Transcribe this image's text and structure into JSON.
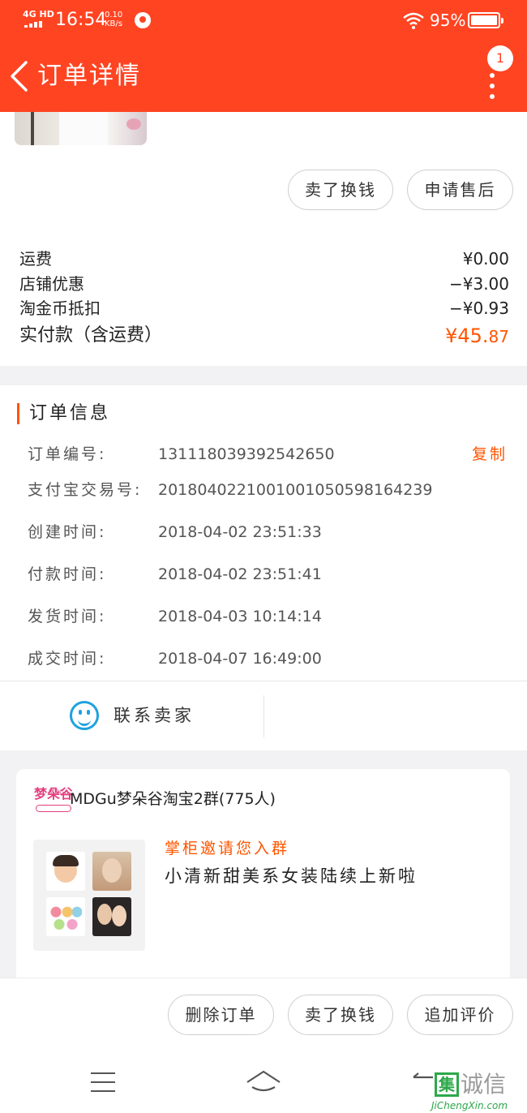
{
  "status_bar": {
    "network": "4G HD",
    "time": "16:54",
    "speed_value": "0.10",
    "speed_unit": "KB/s",
    "battery": "95%"
  },
  "nav": {
    "title": "订单详情",
    "badge_count": "1"
  },
  "product_actions": {
    "sell": "卖了换钱",
    "after_sale": "申请售后"
  },
  "fees": {
    "shipping_label": "运费",
    "shipping_value": "¥0.00",
    "shop_discount_label": "店铺优惠",
    "shop_discount_value": "−¥3.00",
    "coins_label": "淘金币抵扣",
    "coins_value": "−¥0.93",
    "total_label": "实付款（含运费）",
    "total_value_int": "¥45.",
    "total_value_dec": "87"
  },
  "order_info": {
    "title": "订单信息",
    "order_no_label": "订单编号:",
    "order_no": "131118039392542650",
    "copy": "复制",
    "alipay_label": "支付宝交易号:",
    "alipay_no": "2018040221001001050598164239",
    "created_label": "创建时间:",
    "created": "2018-04-02 23:51:33",
    "paid_label": "付款时间:",
    "paid": "2018-04-02 23:51:41",
    "shipped_label": "发货时间:",
    "shipped": "2018-04-03 10:14:14",
    "completed_label": "成交时间:",
    "completed": "2018-04-07 16:49:00"
  },
  "contact": {
    "label": "联系卖家"
  },
  "group": {
    "logo_text": "梦朵谷",
    "logo_sub": "MDGu",
    "name": "MDGu梦朵谷淘宝2群(775人)",
    "invite": "掌柜邀请您入群",
    "intro": "小清新甜美系女装陆续上新啦"
  },
  "bottom_actions": {
    "delete": "删除订单",
    "sell": "卖了换钱",
    "review": "追加评价"
  },
  "watermark": {
    "box": "集",
    "text": "诚信",
    "url": "JiChengXin.com"
  },
  "colors": {
    "header_red": "#ff4422",
    "price_orange": "#ff5500",
    "contact_blue": "#1fa2de"
  }
}
